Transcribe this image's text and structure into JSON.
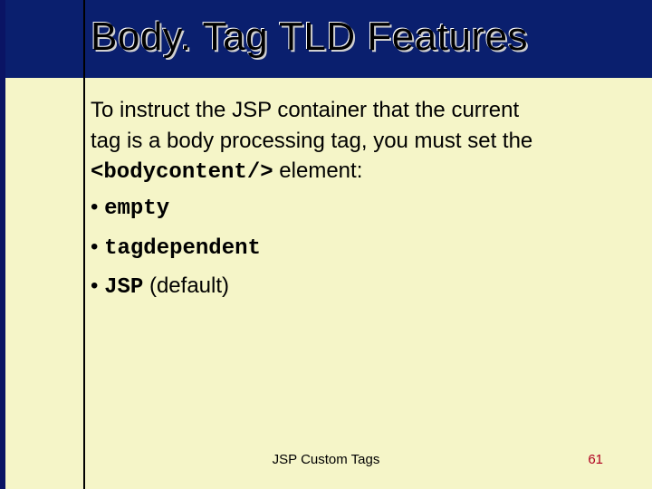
{
  "slide": {
    "title": "Body. Tag TLD Features",
    "paragraph": {
      "line1": "To instruct the JSP container that the current",
      "line2": "tag is a body processing tag, you must set the",
      "code": "<bodycontent/>",
      "line3_suffix": " element:"
    },
    "bullets": [
      {
        "code": "empty",
        "suffix": ""
      },
      {
        "code": "tagdependent",
        "suffix": ""
      },
      {
        "code": "JSP",
        "suffix": " (default)"
      }
    ],
    "footer": "JSP Custom Tags",
    "page_number": "61"
  }
}
